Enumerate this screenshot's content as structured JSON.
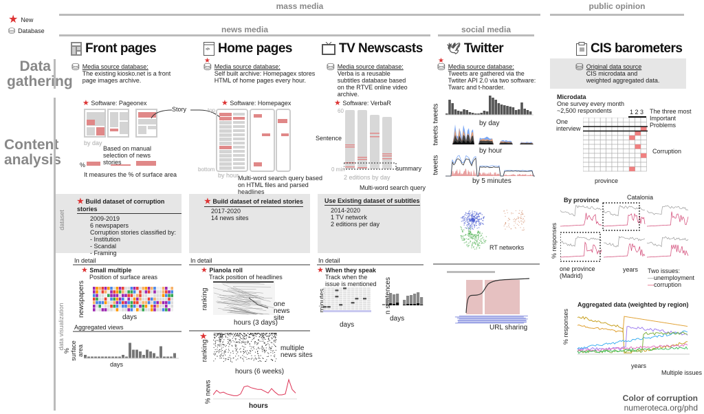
{
  "legend": {
    "new": "New",
    "database": "Database"
  },
  "headers": {
    "mass_media": "mass media",
    "public_opinion": "public opinion",
    "news_media": "news media",
    "social_media": "social media"
  },
  "rows": {
    "data_gathering": "Data gathering",
    "content_analysis": "Content analysis",
    "dataset": "dataset",
    "data_visualization": "data visualization"
  },
  "columns": {
    "front_pages": {
      "title": "Front pages",
      "source_label": "Media source database:",
      "source_text": "The existing kiosko.net is a front page images archive.",
      "software": "Software: Pageonex",
      "story": "Story",
      "by_day": "by day",
      "note1": "Based on manual selection of news stories",
      "pct": "%",
      "note2": "It measures the % of surface area",
      "dataset_title": "Build dataset of corruption stories",
      "dataset_lines": [
        "2009-2019",
        "6 newspapers",
        "Corruption stories classified by:",
        "- Institution",
        "- Scandal",
        "- Framing"
      ],
      "in_detail": "In detail",
      "viz_title": "Small multiple",
      "viz_sub": "Position of surface areas",
      "viz_ylabel": "newspapers",
      "viz_xlabel": "days",
      "agg_title": "Aggregated views",
      "agg_ylabel": "% surface area",
      "agg_xlabel": "days"
    },
    "home_pages": {
      "title": "Home pages",
      "source_label": "Media source database:",
      "source_text": "Self built archive: Homepagex stores HTML of home pages every hour.",
      "software": "Software: Homepagex",
      "top": "top",
      "bottom": "bottom",
      "by_hour": "by hour",
      "note": "Multi-word search query based on HTML files and parsed headlines",
      "dataset_title": "Build dataset of related stories",
      "dataset_lines": [
        "2017-2020",
        "14 news sites"
      ],
      "in_detail": "In detail",
      "viz_title": "Pianola roll",
      "viz_sub": "Track position of headlines",
      "viz_ylabel": "ranking",
      "viz_xlabel": "hours (3 days)",
      "viz_note": "one news site",
      "viz2_ylabel": "ranking",
      "viz2_xlabel": "hours (6 weeks)",
      "viz2_note": "multiple news sites",
      "viz3_ylabel": "% news",
      "viz3_xlabel": "hours"
    },
    "tv_newscasts": {
      "title": "TV Newscasts",
      "source_label": "Media source database:",
      "source_text": "Verba is a reusable subtitles database based on the RTVE online video archive.",
      "software": "Software: VerbaR",
      "axis_top": "60",
      "axis_bottom": "0 min",
      "sentence": "Sentence",
      "summary": "summary",
      "editions": "2 editions by day",
      "note": "Multi-word search query",
      "dataset_title": "Use Existing dataset of subtitles",
      "dataset_lines": [
        "2014-2020",
        "1 TV network",
        "2 editions per day"
      ],
      "in_detail": "In detail",
      "viz_title": "When they speak",
      "viz_sub": "Track when the issue is mentioned",
      "viz_ylabel": "minutes",
      "viz_xlabel": "days",
      "viz2_ylabel": "n sentences",
      "viz2_xlabel": "days"
    },
    "twitter": {
      "title": "Twitter",
      "source_label": "Media source database:",
      "source_text": "Tweets are gathered via the Twtiter API 2.0 via two software: Twarc and t-hoarder.",
      "ylabel": "tweets",
      "by_day": "by day",
      "by_hour": "by hour",
      "by_5min": "by 5 minutes",
      "rt_networks": "RT networks",
      "url_sharing": "URL sharing"
    },
    "cis": {
      "title": "CIS barometers",
      "source_label": "Original data source",
      "source_text": "CIS microdata and weighted aggregated data.",
      "microdata": "Microdata",
      "micro_lines": [
        "One survey every month",
        "~2,500 respondents"
      ],
      "cols_label": "1 2 3",
      "three_problems": "The three most Important Problems",
      "one_interview": "One interview",
      "corruption": "Corruption",
      "province": "province",
      "by_province": "By province",
      "catalonia": "Catalonia",
      "pct_responses": "% responses",
      "one_province": "one province (Madrid)",
      "years": "years",
      "two_issues": "Two issues:",
      "unemployment": "unemployment",
      "corruption_l": "corruption",
      "aggregated": "Aggregated data (weighted by region)",
      "agg_ylabel": "% responses",
      "agg_xlabel": "years",
      "multiple": "Multiple issues"
    }
  },
  "footer": {
    "title": "Color of corruption",
    "url": "numeroteca.org/phd"
  },
  "colors": {
    "accent": "#d33333",
    "pink": "#e08888",
    "header_grey": "#888888"
  }
}
